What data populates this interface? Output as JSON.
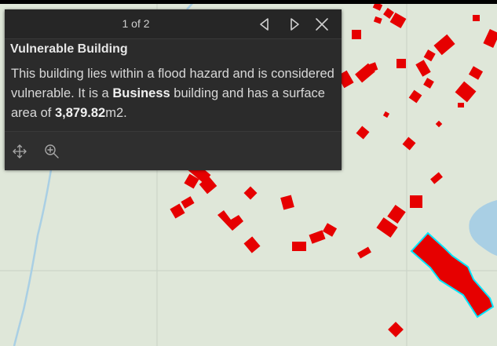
{
  "popup": {
    "pager": "1 of 2",
    "title": "Vulnerable Building",
    "body": {
      "pre": "This building lies within a flood hazard and is considered vulnerable. It is a ",
      "type": "Business",
      "mid": " building and has a surface area of ",
      "area": "3,879.82",
      "unit": "m2."
    }
  },
  "icons": {
    "previous": "triangle-left-icon",
    "next": "triangle-right-icon",
    "close": "close-icon",
    "pan": "move-icon",
    "zoom": "zoom-in-icon"
  },
  "colors": {
    "map_background": "#dfe7d9",
    "water": "#a9cfe4",
    "building_fill": "#e60000",
    "selected_outline": "#00e5ff",
    "popup_background": "#2b2b2b"
  }
}
